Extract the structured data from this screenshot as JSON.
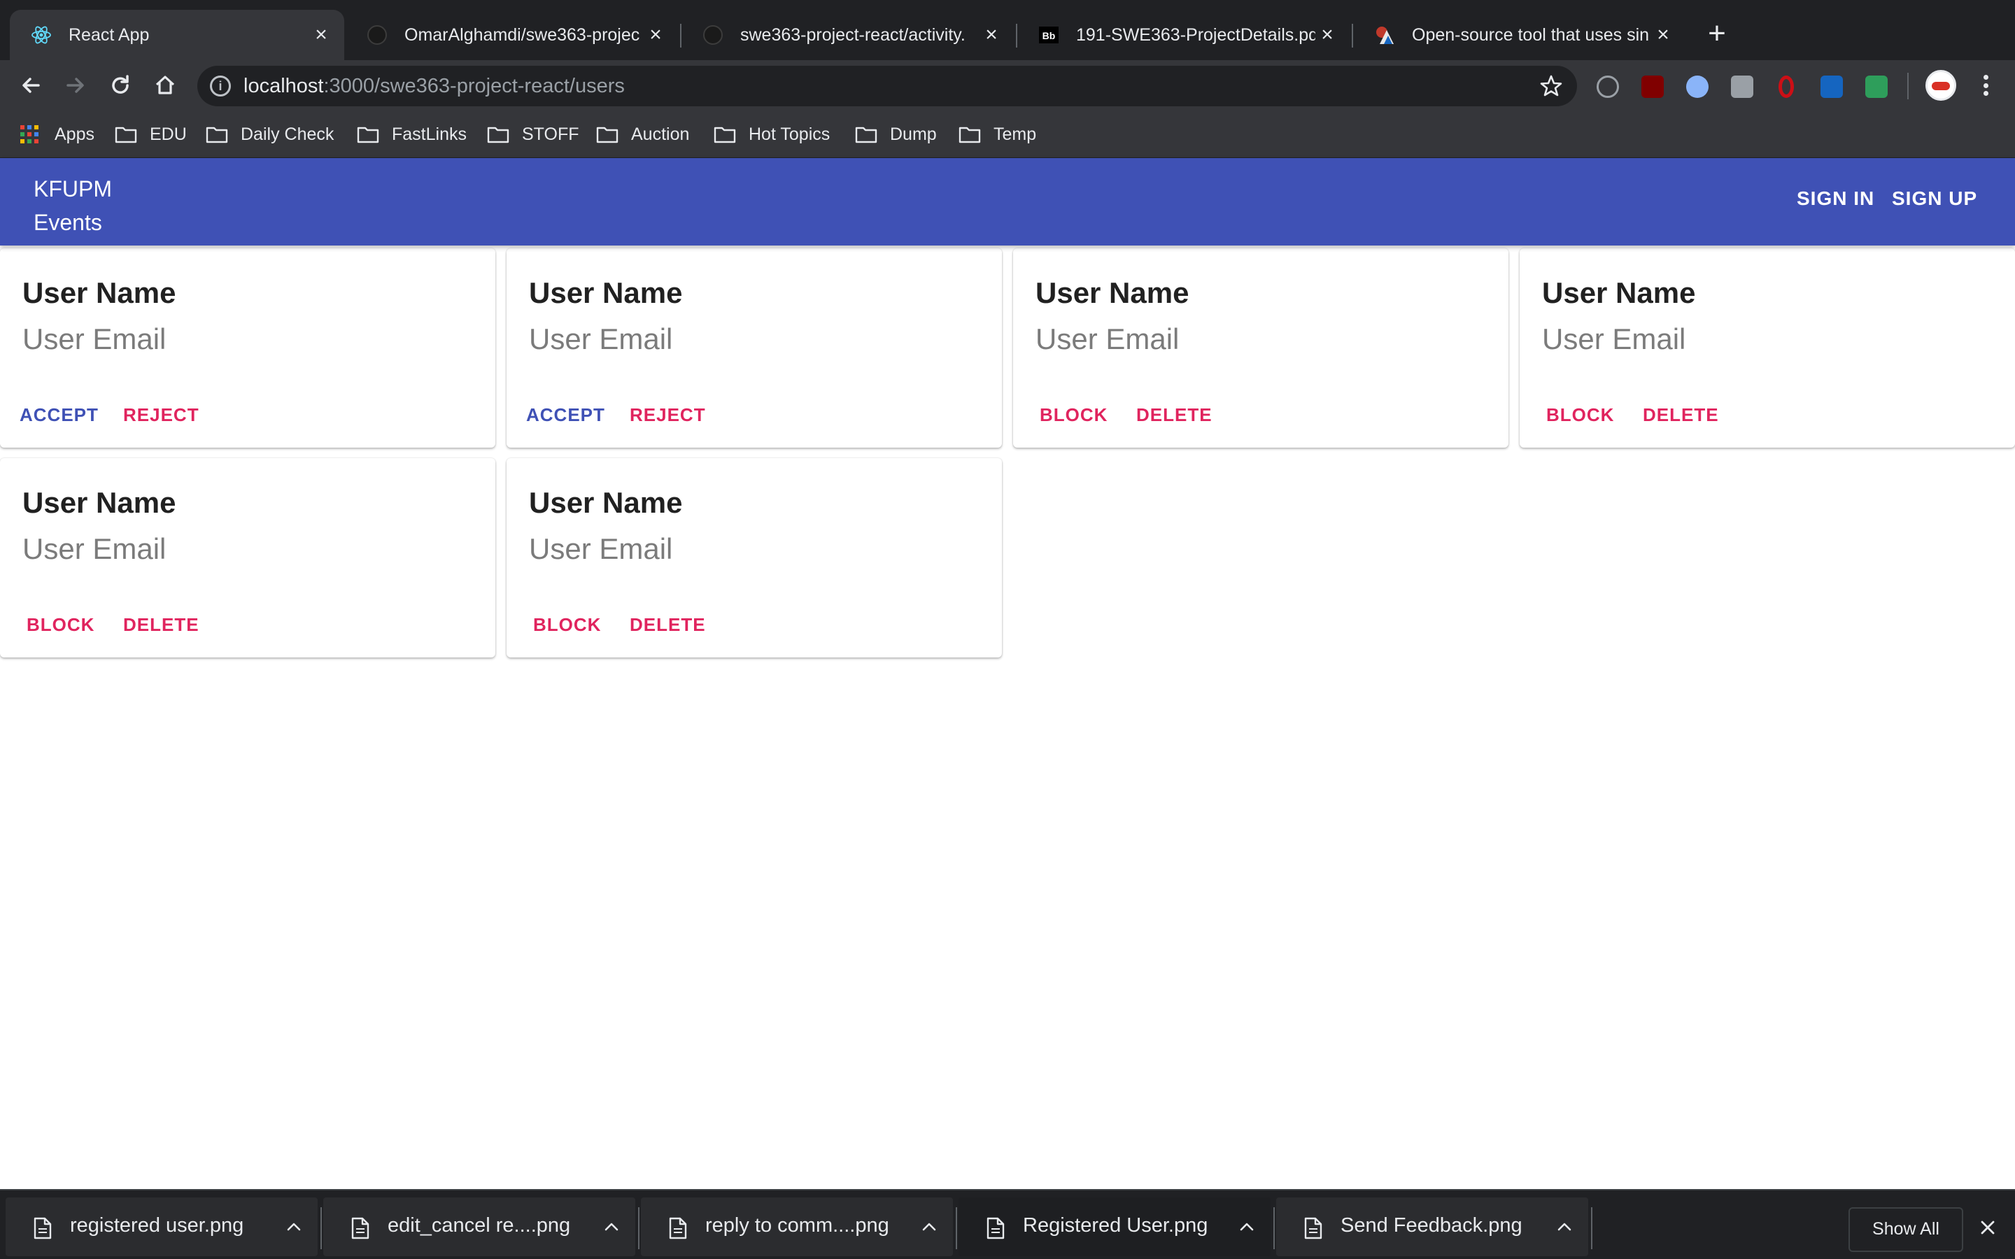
{
  "browser": {
    "tabs": [
      {
        "title": "React App",
        "active": true,
        "icon": "react-icon"
      },
      {
        "title": "OmarAlghamdi/swe363-projec",
        "active": false,
        "icon": "github-icon"
      },
      {
        "title": "swe363-project-react/activity.",
        "active": false,
        "icon": "github-icon"
      },
      {
        "title": "191-SWE363-ProjectDetails.pd",
        "active": false,
        "icon": "blackboard-icon"
      },
      {
        "title": "Open-source tool that uses sin",
        "active": false,
        "icon": "site-icon"
      }
    ],
    "url_host": "localhost",
    "url_path": ":3000/swe363-project-react/users",
    "bookmarks": [
      {
        "label": "Apps",
        "icon": "apps-grid-icon"
      },
      {
        "label": "EDU",
        "icon": "folder-icon"
      },
      {
        "label": "Daily Check",
        "icon": "folder-icon"
      },
      {
        "label": "FastLinks",
        "icon": "folder-icon"
      },
      {
        "label": "STOFF",
        "icon": "folder-icon"
      },
      {
        "label": "Auction",
        "icon": "folder-icon"
      },
      {
        "label": "Hot Topics",
        "icon": "folder-icon"
      },
      {
        "label": "Dump",
        "icon": "folder-icon"
      },
      {
        "label": "Temp",
        "icon": "folder-icon"
      }
    ],
    "downloads": [
      {
        "name": "registered user.png"
      },
      {
        "name": "edit_cancel re....png"
      },
      {
        "name": "reply to comm....png"
      },
      {
        "name": "Registered User.png"
      },
      {
        "name": "Send Feedback.png"
      }
    ],
    "show_all_label": "Show All"
  },
  "app": {
    "brand_line1": "KFUPM",
    "brand_line2": "Events",
    "nav": {
      "sign_in": "SIGN IN",
      "sign_up": "SIGN UP"
    },
    "colors": {
      "primary": "#3f51b5",
      "danger": "#e0245e"
    },
    "users": [
      {
        "name": "User Name",
        "email": "User Email",
        "actions": [
          "ACCEPT",
          "REJECT"
        ]
      },
      {
        "name": "User Name",
        "email": "User Email",
        "actions": [
          "ACCEPT",
          "REJECT"
        ]
      },
      {
        "name": "User Name",
        "email": "User Email",
        "actions": [
          "BLOCK",
          "DELETE"
        ]
      },
      {
        "name": "User Name",
        "email": "User Email",
        "actions": [
          "BLOCK",
          "DELETE"
        ]
      },
      {
        "name": "User Name",
        "email": "User Email",
        "actions": [
          "BLOCK",
          "DELETE"
        ]
      },
      {
        "name": "User Name",
        "email": "User Email",
        "actions": [
          "BLOCK",
          "DELETE"
        ]
      }
    ]
  }
}
